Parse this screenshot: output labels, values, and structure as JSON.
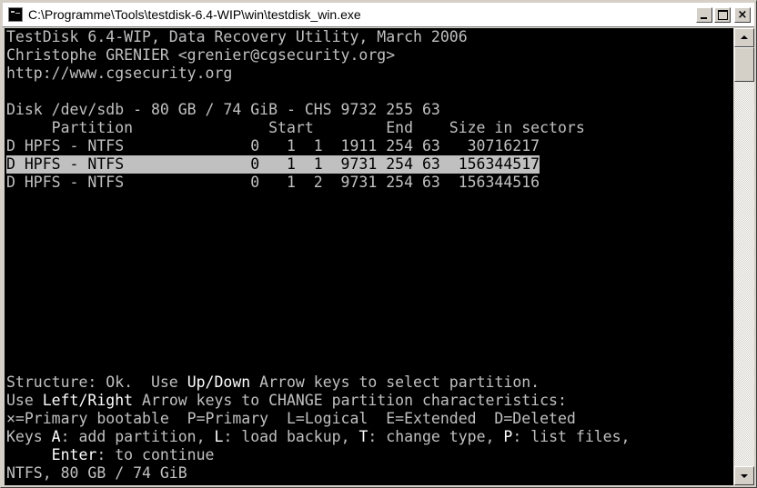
{
  "window": {
    "title": "C:\\Programme\\Tools\\testdisk-6.4-WIP\\win\\testdisk_win.exe",
    "icon": "console-app-icon",
    "minimize_label": "",
    "maximize_label": "",
    "close_label": "×"
  },
  "console": {
    "fg_color": "#c0c0c0",
    "bg_color": "#000000",
    "header": {
      "line1": "TestDisk 6.4-WIP, Data Recovery Utility, March 2006",
      "line2": "Christophe GRENIER <grenier@cgsecurity.org>",
      "line3": "http://www.cgsecurity.org"
    },
    "disk_info": "Disk /dev/sdb - 80 GB / 74 GiB - CHS 9732 255 63",
    "table_header": "     Partition               Start        End    Size in sectors",
    "partitions": [
      {
        "row": "D HPFS - NTFS              0   1  1  1911 254 63   30716217",
        "selected": false
      },
      {
        "row": "D HPFS - NTFS              0   1  1  9731 254 63  156344517",
        "selected": true
      },
      {
        "row": "D HPFS - NTFS              0   1  2  9731 254 63  156344516",
        "selected": false
      }
    ],
    "footer": {
      "structure_pre": "Structure: Ok.  Use ",
      "structure_key": "Up/Down",
      "structure_post": " Arrow keys to select partition.",
      "use_pre": "Use ",
      "use_key": "Left/Right",
      "use_post": " Arrow keys to CHANGE partition characteristics:",
      "legend": "×=Primary bootable  P=Primary  L=Logical  E=Extended  D=Deleted",
      "keys_pre": "Keys ",
      "keys_a": "A",
      "keys_a_text": ": add partition, ",
      "keys_l": "L",
      "keys_l_text": ": load backup, ",
      "keys_t": "T",
      "keys_t_text": ": change type, ",
      "keys_p": "P",
      "keys_p_text": ": list files,",
      "enter_indent": "     ",
      "enter_key": "Enter",
      "enter_text": ": to continue",
      "status": "NTFS, 80 GB / 74 GiB"
    }
  }
}
